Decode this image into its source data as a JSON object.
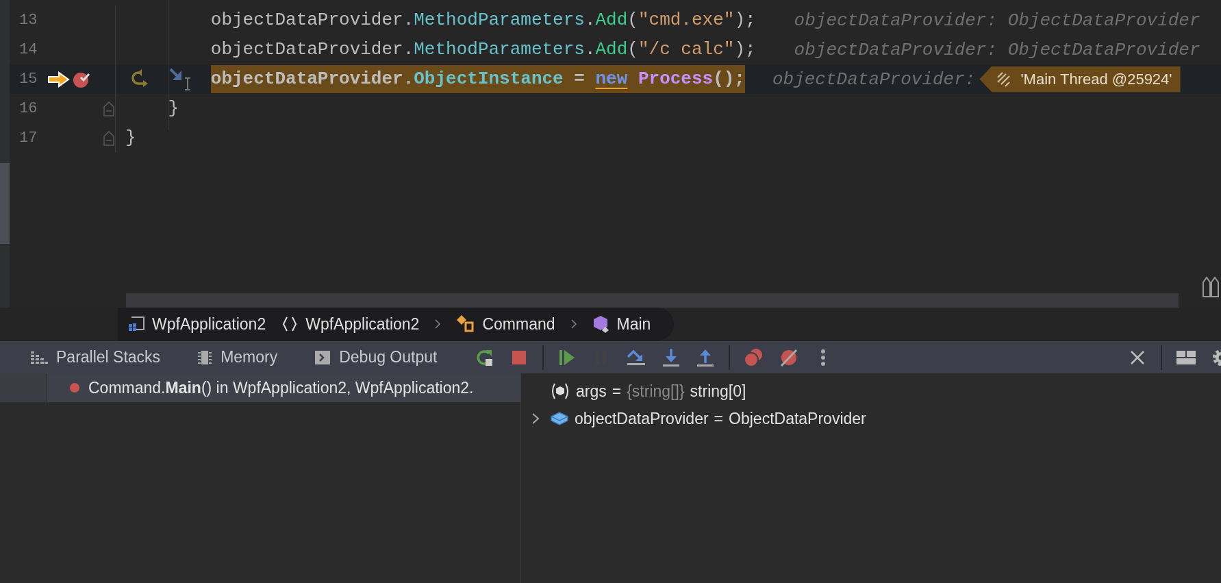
{
  "editor": {
    "lines": [
      {
        "number": "13",
        "kind": "statement",
        "current": false,
        "fold": false,
        "tokens": [
          {
            "kind": "plain",
            "text": "objectDataProvider."
          },
          {
            "kind": "member",
            "text": "MethodParameters"
          },
          {
            "kind": "plain",
            "text": "."
          },
          {
            "kind": "method",
            "text": "Add"
          },
          {
            "kind": "plain",
            "text": "("
          },
          {
            "kind": "string",
            "text": "\"cmd.exe\""
          },
          {
            "kind": "plain",
            "text": ");"
          }
        ],
        "hint": "objectDataProvider: ObjectDataProvider"
      },
      {
        "number": "14",
        "kind": "statement",
        "current": false,
        "fold": false,
        "tokens": [
          {
            "kind": "plain",
            "text": "objectDataProvider."
          },
          {
            "kind": "member",
            "text": "MethodParameters"
          },
          {
            "kind": "plain",
            "text": "."
          },
          {
            "kind": "method",
            "text": "Add"
          },
          {
            "kind": "plain",
            "text": "("
          },
          {
            "kind": "string",
            "text": "\"/c calc\""
          },
          {
            "kind": "plain",
            "text": ");"
          }
        ],
        "hint": "objectDataProvider: ObjectDataProvider"
      },
      {
        "number": "15",
        "kind": "statement",
        "current": true,
        "fold": false,
        "gutter": [
          {
            "kind": "execution-point"
          },
          {
            "kind": "breakpoint"
          }
        ],
        "inline_hints": [
          {
            "kind": "smart-step"
          },
          {
            "kind": "step-into"
          }
        ],
        "tokens": [
          {
            "kind": "plain",
            "text": "objectDataProvider."
          },
          {
            "kind": "member",
            "text": "ObjectInstance"
          },
          {
            "kind": "plain",
            "text": " = "
          },
          {
            "kind": "keyword",
            "text": "new"
          },
          {
            "kind": "type",
            "text": "Process"
          },
          {
            "kind": "plain",
            "text": "();"
          }
        ],
        "hint": "objectDataProvider:",
        "badge": "'Main Thread @25924'"
      },
      {
        "number": "16",
        "kind": "block-end",
        "current": false,
        "fold": true,
        "tokens": [
          {
            "kind": "plain",
            "text": "}"
          }
        ]
      },
      {
        "number": "17",
        "kind": "class-end",
        "current": false,
        "fold": true,
        "tokens": [
          {
            "kind": "plain",
            "text": "}"
          }
        ]
      }
    ]
  },
  "breadcrumbs": [
    {
      "kind": "project",
      "label": "WpfApplication2",
      "chevron": false
    },
    {
      "kind": "namespace",
      "label": "WpfApplication2",
      "chevron": false
    },
    {
      "kind": "class",
      "label": "Command",
      "chevron": true
    },
    {
      "kind": "method",
      "label": "Main",
      "chevron": true
    }
  ],
  "debug_toolbar": {
    "tabs": [
      {
        "kind": "stacks",
        "label": "Parallel Stacks",
        "selected": false
      },
      {
        "kind": "memory",
        "label": "Memory",
        "selected": false
      },
      {
        "kind": "output",
        "label": "Debug Output",
        "selected": false
      }
    ],
    "actions": [
      {
        "kind": "rerun",
        "disabled": false
      },
      {
        "kind": "stop",
        "disabled": false
      },
      {
        "kind": "separator"
      },
      {
        "kind": "resume",
        "disabled": false
      },
      {
        "kind": "pause",
        "disabled": true
      },
      {
        "kind": "step-over",
        "disabled": false
      },
      {
        "kind": "step-into",
        "disabled": false
      },
      {
        "kind": "step-out",
        "disabled": false
      },
      {
        "kind": "separator"
      },
      {
        "kind": "breakpoints",
        "disabled": false
      },
      {
        "kind": "mute",
        "disabled": false
      },
      {
        "kind": "more",
        "disabled": false
      }
    ],
    "right_actions": [
      {
        "kind": "close"
      },
      {
        "kind": "separator"
      },
      {
        "kind": "layout"
      },
      {
        "kind": "settings"
      }
    ]
  },
  "frames": [
    {
      "text": "Command.**Main**() in WpfApplication2, WpfApplication2.",
      "selected": true
    }
  ],
  "variables": [
    {
      "kind": "parameter",
      "name": "args",
      "separator": "=",
      "type": "{string[]}",
      "value": "string[0]"
    },
    {
      "kind": "field",
      "name": "objectDataProvider",
      "separator": "=",
      "value": "ObjectDataProvider",
      "expanded": false
    }
  ]
}
